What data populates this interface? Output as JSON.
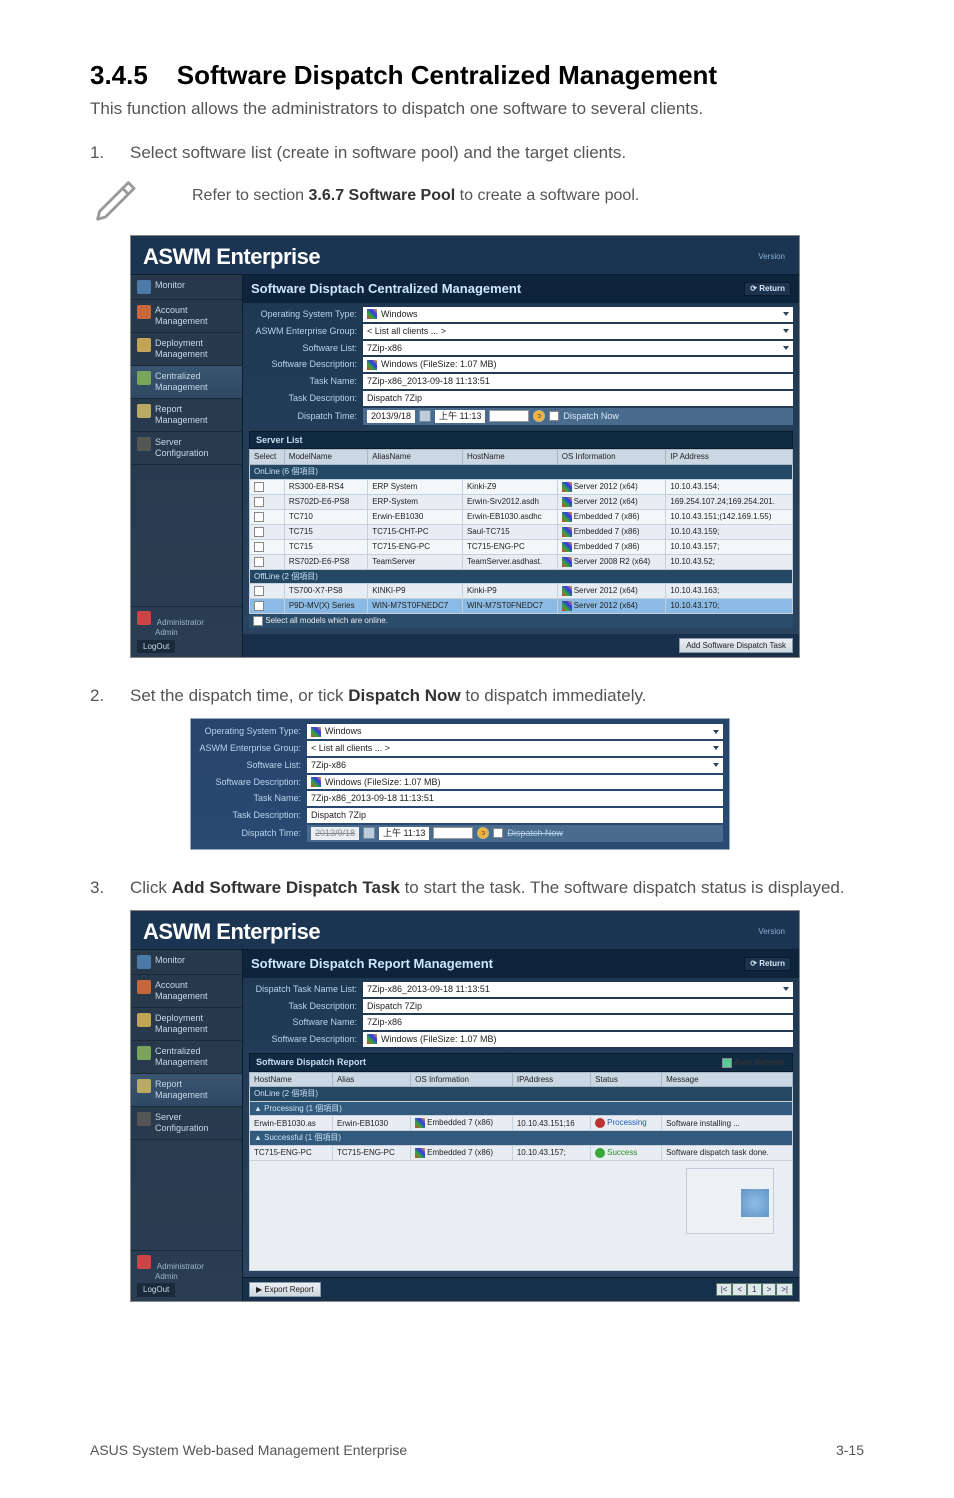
{
  "section": {
    "number": "3.4.5",
    "title": "Software Dispatch Centralized Management",
    "intro": "This function allows the administrators to dispatch one software to several clients."
  },
  "steps": {
    "s1_num": "1.",
    "s1_text": "Select software list (create in software pool) and the target clients.",
    "s2_num": "2.",
    "s2_text_a": "Set the dispatch time, or tick ",
    "s2_text_b": "Dispatch Now",
    "s2_text_c": " to dispatch immediately.",
    "s3_num": "3.",
    "s3_text_a": "Click ",
    "s3_text_b": "Add Software Dispatch Task",
    "s3_text_c": " to start the task. The software dispatch status is displayed."
  },
  "note": {
    "text_a": "Refer to section ",
    "text_b": "3.6.7 Software Pool",
    "text_c": " to create a software pool."
  },
  "brand": "ASWM Enterprise",
  "version_label": "Version",
  "return_label": "Return",
  "sidebar": {
    "items": [
      {
        "label": "Monitor"
      },
      {
        "label": "Account Management"
      },
      {
        "label": "Deployment Management"
      },
      {
        "label": "Centralized Management"
      },
      {
        "label": "Report Management"
      },
      {
        "label": "Server Configuration"
      }
    ],
    "admin": "Administrator",
    "admin_sub": "Admin",
    "logout": "LogOut"
  },
  "panel1": {
    "title": "Software Disptach Centralized Management",
    "labels": {
      "os_type": "Operating System Type:",
      "group": "ASWM Enterprise Group:",
      "sw_list": "Software List:",
      "sw_desc": "Software Description:",
      "task_name": "Task Name:",
      "task_desc": "Task Description:",
      "dispatch_time": "Dispatch Time:"
    },
    "values": {
      "os_type": "Windows",
      "group": "< List all clients ... >",
      "sw_list": "7Zip-x86",
      "sw_desc": "Windows  (FileSize: 1.07 MB)",
      "task_name": "7Zip-x86_2013-09-18 11:13:51",
      "task_desc": "Dispatch 7Zip",
      "date": "2013/9/18",
      "time": "上午 11:13",
      "dispatch_now": "Dispatch Now"
    },
    "server_list_label": "Server List",
    "group_online": "OnLine (6 個項目)",
    "group_offline": "OffLine (2 個項目)",
    "columns": [
      "Select",
      "ModelName",
      "AliasName",
      "HostName",
      "OS Information",
      "IP Address"
    ],
    "rows_online": [
      {
        "model": "RS300-E8-RS4",
        "alias": "ERP System",
        "host": "Kinki-Z9",
        "os": "Server 2012 (x64)",
        "ip": "10.10.43.154;"
      },
      {
        "model": "RS702D-E6-PS8",
        "alias": "ERP-System",
        "host": "Erwin-Srv2012.asdh",
        "os": "Server 2012 (x64)",
        "ip": "169.254.107.24;169.254.201."
      },
      {
        "model": "TC710",
        "alias": "Erwin-EB1030",
        "host": "Erwin-EB1030.asdhc",
        "os": "Embedded 7 (x86)",
        "ip": "10.10.43.151;(142.169.1.55)"
      },
      {
        "model": "TC715",
        "alias": "TC715-CHT-PC",
        "host": "Saul-TC715",
        "os": "Embedded 7 (x86)",
        "ip": "10.10.43.159;"
      },
      {
        "model": "TC715",
        "alias": "TC715-ENG-PC",
        "host": "TC715-ENG-PC",
        "os": "Embedded 7 (x86)",
        "ip": "10.10.43.157;"
      },
      {
        "model": "RS702D-E6-PS8",
        "alias": "TeamServer",
        "host": "TeamServer.asdhast.",
        "os": "Server 2008 R2 (x64)",
        "ip": "10.10.43.52;"
      }
    ],
    "rows_offline": [
      {
        "model": "TS700-X7-PS8",
        "alias": "KINKI-P9",
        "host": "Kinki-P9",
        "os": "Server 2012 (x64)",
        "ip": "10.10.43.163;"
      },
      {
        "model": "P9D-MV(X) Series",
        "alias": "WIN-M7ST0FNEDC7",
        "host": "WIN-M7ST0FNEDC7",
        "os": "Server 2012 (x64)",
        "ip": "10.10.43.170;"
      }
    ],
    "select_all": "Select all models which are online.",
    "add_task": "Add Software Dispatch Task"
  },
  "panel3": {
    "title": "Software Dispatch Report Management",
    "labels": {
      "dtnl": "Dispatch Task Name List:",
      "task_desc": "Task Description:",
      "sw_name": "Software Name:",
      "sw_desc": "Software Description:"
    },
    "values": {
      "dtnl": "7Zip-x86_2013-09-18 11:13:51",
      "task_desc": "Dispatch 7Zip",
      "sw_name": "7Zip-x86",
      "sw_desc": "Windows  (FileSize: 1.07 MB)"
    },
    "report_hdr": "Software Dispatch Report",
    "auto_refresh": "Auto Refresh",
    "columns": [
      "HostName",
      "Alias",
      "OS Information",
      "IPAddress",
      "Status",
      "Message"
    ],
    "group_online": "OnLine (2 個項目)",
    "group_proc": "Processing (1 個項目)",
    "group_succ": "Successful (1 個項目)",
    "rows": {
      "proc": {
        "host": "Erwin-EB1030.as",
        "alias": "Erwin-EB1030",
        "os": "Embedded 7 (x86)",
        "ip": "10.10.43.151;16",
        "status": "Processing",
        "msg": "Software installing ..."
      },
      "succ": {
        "host": "TC715-ENG-PC",
        "alias": "TC715-ENG-PC",
        "os": "Embedded 7 (x86)",
        "ip": "10.10.43.157;",
        "status": "Success",
        "msg": "Software dispatch task done."
      }
    },
    "export": "Export Report",
    "pager": [
      "|<",
      "<",
      "1",
      ">",
      ">|"
    ]
  },
  "footer": {
    "left": "ASUS System Web-based Management Enterprise",
    "right": "3-15"
  }
}
